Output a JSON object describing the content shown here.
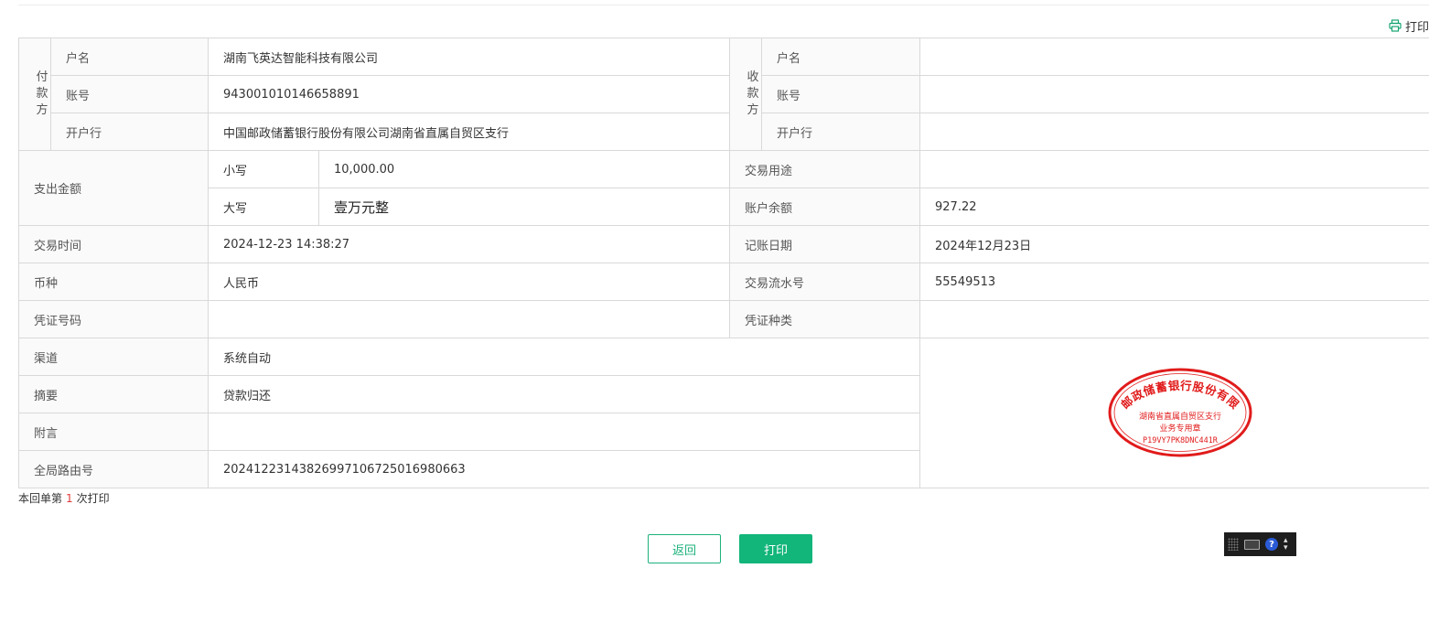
{
  "toolbar": {
    "print_link": "打印"
  },
  "payer": {
    "side_label": "付款方",
    "name_label": "户名",
    "name": "湖南飞英达智能科技有限公司",
    "account_label": "账号",
    "account": "943001010146658891",
    "bank_label": "开户行",
    "bank": "中国邮政储蓄银行股份有限公司湖南省直属自贸区支行"
  },
  "payee": {
    "side_label": "收款方",
    "name_label": "户名",
    "name": "",
    "account_label": "账号",
    "account": "",
    "bank_label": "开户行",
    "bank": ""
  },
  "amount": {
    "label": "支出金额",
    "small_label": "小写",
    "small": "10,000.00",
    "big_label": "大写",
    "big": "壹万元整"
  },
  "purpose": {
    "label": "交易用途",
    "value": ""
  },
  "balance": {
    "label": "账户余额",
    "value": "927.22"
  },
  "trade_time": {
    "label": "交易时间",
    "value": "2024-12-23 14:38:27"
  },
  "book_date": {
    "label": "记账日期",
    "value": "2024年12月23日"
  },
  "currency": {
    "label": "币种",
    "value": "人民币"
  },
  "serial": {
    "label": "交易流水号",
    "value": "55549513"
  },
  "voucher_no": {
    "label": "凭证号码",
    "value": ""
  },
  "voucher_type": {
    "label": "凭证种类",
    "value": ""
  },
  "channel": {
    "label": "渠道",
    "value": "系统自动"
  },
  "summary": {
    "label": "摘要",
    "value": "贷款归还"
  },
  "postscript": {
    "label": "附言",
    "value": ""
  },
  "route": {
    "label": "全局路由号",
    "value": "20241223143826997106725016980663"
  },
  "seal": {
    "ring_text": "中国邮政储蓄银行股份有限公司",
    "line1": "湖南省直属自贸区支行",
    "line2": "业务专用章",
    "code": "P19VY7PK8DNC441R",
    "color": "#e11b1b"
  },
  "footer": {
    "print_count_prefix": "本回单第",
    "print_count": "1",
    "print_count_suffix": "次打印"
  },
  "actions": {
    "back": "返回",
    "print": "打印"
  },
  "ime": {
    "help": "?"
  }
}
